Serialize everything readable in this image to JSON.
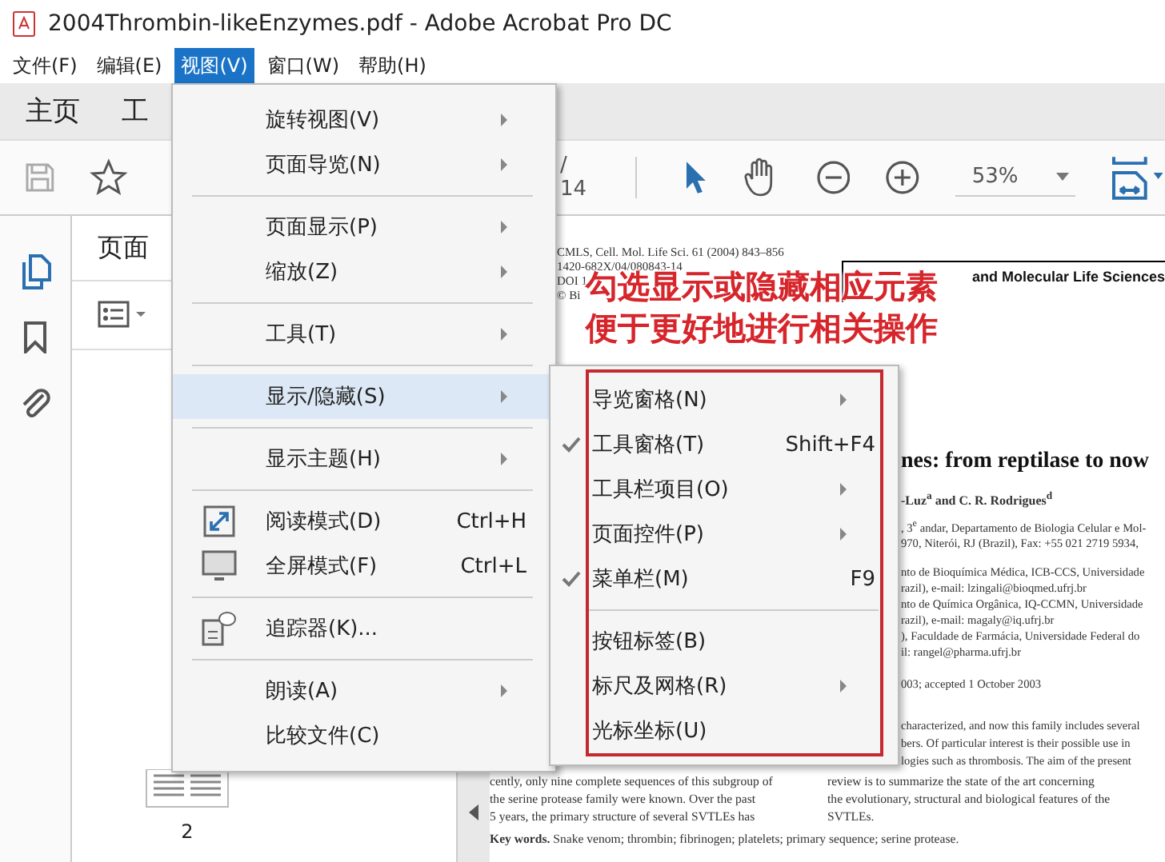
{
  "window": {
    "title": "2004Thrombin-likeEnzymes.pdf - Adobe Acrobat Pro DC"
  },
  "menubar": [
    {
      "label": "文件(F)",
      "selected": false
    },
    {
      "label": "编辑(E)",
      "selected": false
    },
    {
      "label": "视图(V)",
      "selected": true
    },
    {
      "label": "窗口(W)",
      "selected": false
    },
    {
      "label": "帮助(H)",
      "selected": false
    }
  ],
  "tabs": [
    "主页",
    "工"
  ],
  "toolbar": {
    "page_total": "/ 14",
    "zoom": "53%"
  },
  "left_panel": {
    "title": "页面",
    "page_number": "2"
  },
  "document": {
    "header_lines": [
      "CMLS, Cell. Mol. Life Sci. 61 (2004) 843–856",
      "1420-682X/04/080843-14",
      "DOI 1",
      "© Bi"
    ],
    "journal": "and Molecular Life Sciences",
    "title": "nes: from reptilase to now",
    "authors": "-Luz$^{a}$ and C. R. Rodrigues$^{d}$",
    "affiliation_lines": [
      ", 3$^{e}$ andar, Departamento de Biologia Celular e Mol-",
      "970, Niterói, RJ (Brazil), Fax: +55 021 2719 5934,",
      "nto de Bioquímica Médica, ICB-CCS, Universidade",
      "razil), e-mail: lzingali@bioqmed.ufrj.br",
      "nto de Química Orgânica, IQ-CCMN, Universidade",
      "razil), e-mail: magaly@iq.ufrj.br",
      "), Faculdade de Farmácia, Universidade Federal do",
      "il: rangel@pharma.ufrj.br"
    ],
    "received": "003; accepted 1 October 2003",
    "abstract_lines": [
      "characterized, and now this family includes several",
      "bers. Of particular interest is their possible use in",
      "logies such as thrombosis. The aim of the present"
    ],
    "left_column": [
      "cently, only nine complete sequences of this subgroup of",
      "the serine protease family were known. Over the past",
      "5 years, the primary structure of several SVTLEs has"
    ],
    "right_column": [
      "review is to summarize the state of the art concerning",
      "the evolutionary, structural and biological features of the",
      "SVTLEs."
    ],
    "keywords": "**Key words.** Snake venom; thrombin; fibrinogen; platelets; primary sequence; serine protease."
  },
  "annotation": [
    "勾选显示或隐藏相应元素",
    "便于更好地进行相关操作"
  ],
  "view_menu": [
    {
      "kind": "item",
      "label": "旋转视图(V)",
      "submenu": true,
      "highlighted": false
    },
    {
      "kind": "item",
      "label": "页面导览(N)",
      "submenu": true,
      "highlighted": false
    },
    {
      "kind": "separator"
    },
    {
      "kind": "item",
      "label": "页面显示(P)",
      "submenu": true,
      "highlighted": false
    },
    {
      "kind": "item",
      "label": "缩放(Z)",
      "submenu": true,
      "highlighted": false
    },
    {
      "kind": "separator"
    },
    {
      "kind": "item",
      "label": "工具(T)",
      "submenu": true,
      "highlighted": false
    },
    {
      "kind": "separator"
    },
    {
      "kind": "item",
      "label": "显示/隐藏(S)",
      "submenu": true,
      "highlighted": true
    },
    {
      "kind": "separator"
    },
    {
      "kind": "item",
      "label": "显示主题(H)",
      "submenu": true,
      "highlighted": false
    },
    {
      "kind": "separator"
    },
    {
      "kind": "iconitem",
      "label": "阅读模式(D)",
      "shortcut": "Ctrl+H",
      "submenu": false,
      "highlighted": false
    },
    {
      "kind": "iconitem",
      "label": "全屏模式(F)",
      "shortcut": "Ctrl+L",
      "submenu": false,
      "highlighted": false
    },
    {
      "kind": "separator"
    },
    {
      "kind": "iconitem",
      "label": "追踪器(K)...",
      "submenu": false,
      "highlighted": false
    },
    {
      "kind": "separator"
    },
    {
      "kind": "item",
      "label": "朗读(A)",
      "submenu": true,
      "highlighted": false
    },
    {
      "kind": "item",
      "label": "比较文件(C)",
      "submenu": false,
      "highlighted": false
    }
  ],
  "show_hide_menu": [
    {
      "kind": "item",
      "label": "导览窗格(N)",
      "submenu": true,
      "checked": false
    },
    {
      "kind": "item",
      "label": "工具窗格(T)",
      "shortcut": "Shift+F4",
      "submenu": false,
      "checked": true
    },
    {
      "kind": "item",
      "label": "工具栏项目(O)",
      "submenu": true,
      "checked": false
    },
    {
      "kind": "item",
      "label": "页面控件(P)",
      "submenu": true,
      "checked": false
    },
    {
      "kind": "item",
      "label": "菜单栏(M)",
      "shortcut": "F9",
      "submenu": false,
      "checked": true
    },
    {
      "kind": "separator"
    },
    {
      "kind": "item",
      "label": "按钮标签(B)",
      "submenu": false,
      "checked": false
    },
    {
      "kind": "item",
      "label": "标尺及网格(R)",
      "submenu": true,
      "checked": false
    },
    {
      "kind": "item",
      "label": "光标坐标(U)",
      "submenu": false,
      "checked": false
    }
  ]
}
